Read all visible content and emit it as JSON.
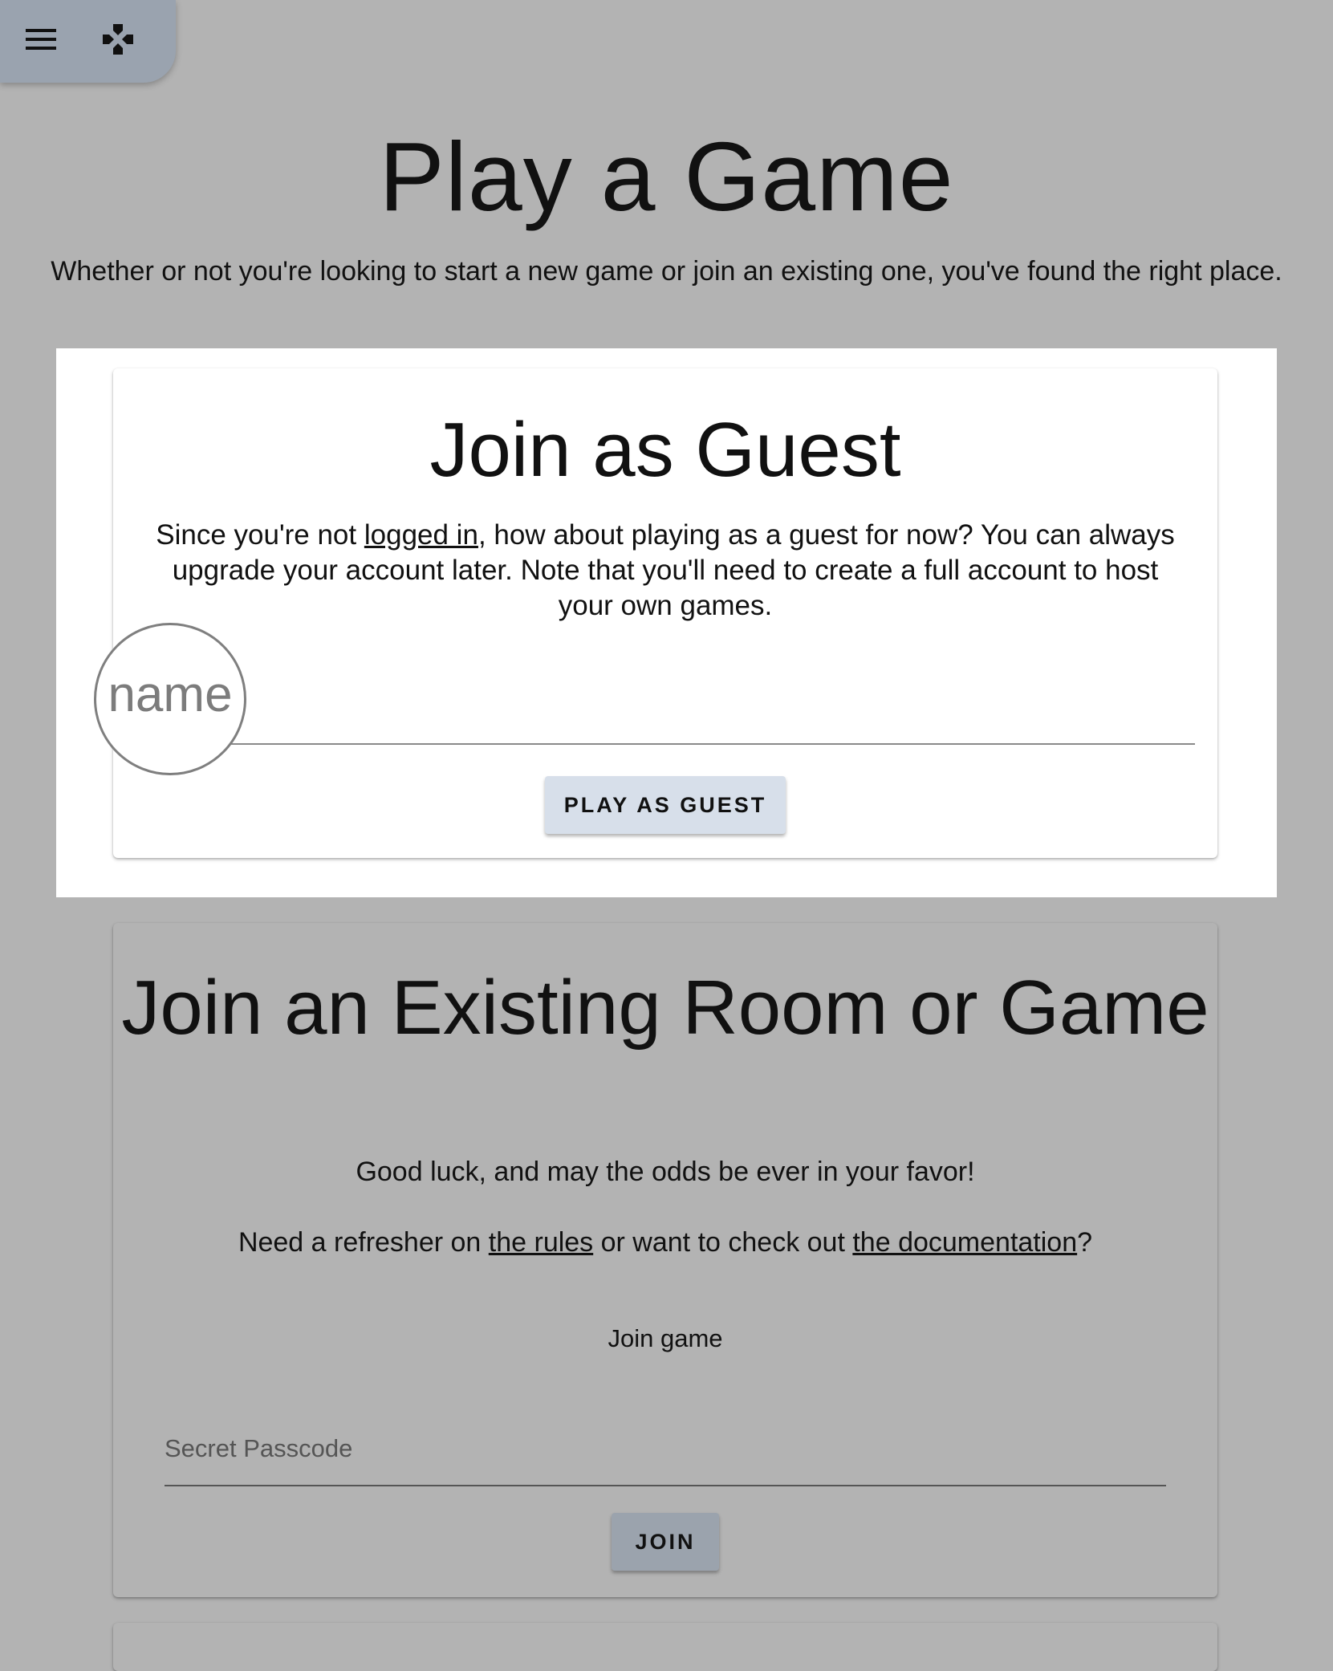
{
  "toolbar": {
    "menu_icon": "hamburger-menu-icon",
    "game_icon": "gamepad-icon"
  },
  "header": {
    "title": "Play a Game",
    "subtitle": "Whether or not you're looking to start a new game or join an existing one, you've found the right place."
  },
  "guest_card": {
    "title": "Join as Guest",
    "text_before_link": "Since you're not ",
    "link_label": "logged in",
    "text_after_link": ", how about playing as a guest for now? You can always upgrade your account later. Note that you'll need to create a full account to host your own games.",
    "name_label": "name",
    "name_value": "",
    "button_label": "PLAY AS GUEST"
  },
  "join_card": {
    "title": "Join an Existing Room or Game",
    "luck_text": "Good luck, and may the odds be ever in your favor!",
    "refresher_prefix": "Need a refresher on ",
    "rules_link": "the rules",
    "refresher_middle": " or want to check out ",
    "docs_link": "the documentation",
    "refresher_suffix": "?",
    "join_label": "Join game",
    "passcode_placeholder": "Secret Passcode",
    "passcode_value": "",
    "button_label": "JOIN"
  },
  "colors": {
    "page_background": "#b3b3b3",
    "toolbar_background": "#9aa3af",
    "guest_button": "#d7dfea",
    "join_button": "#9ba3ad"
  }
}
